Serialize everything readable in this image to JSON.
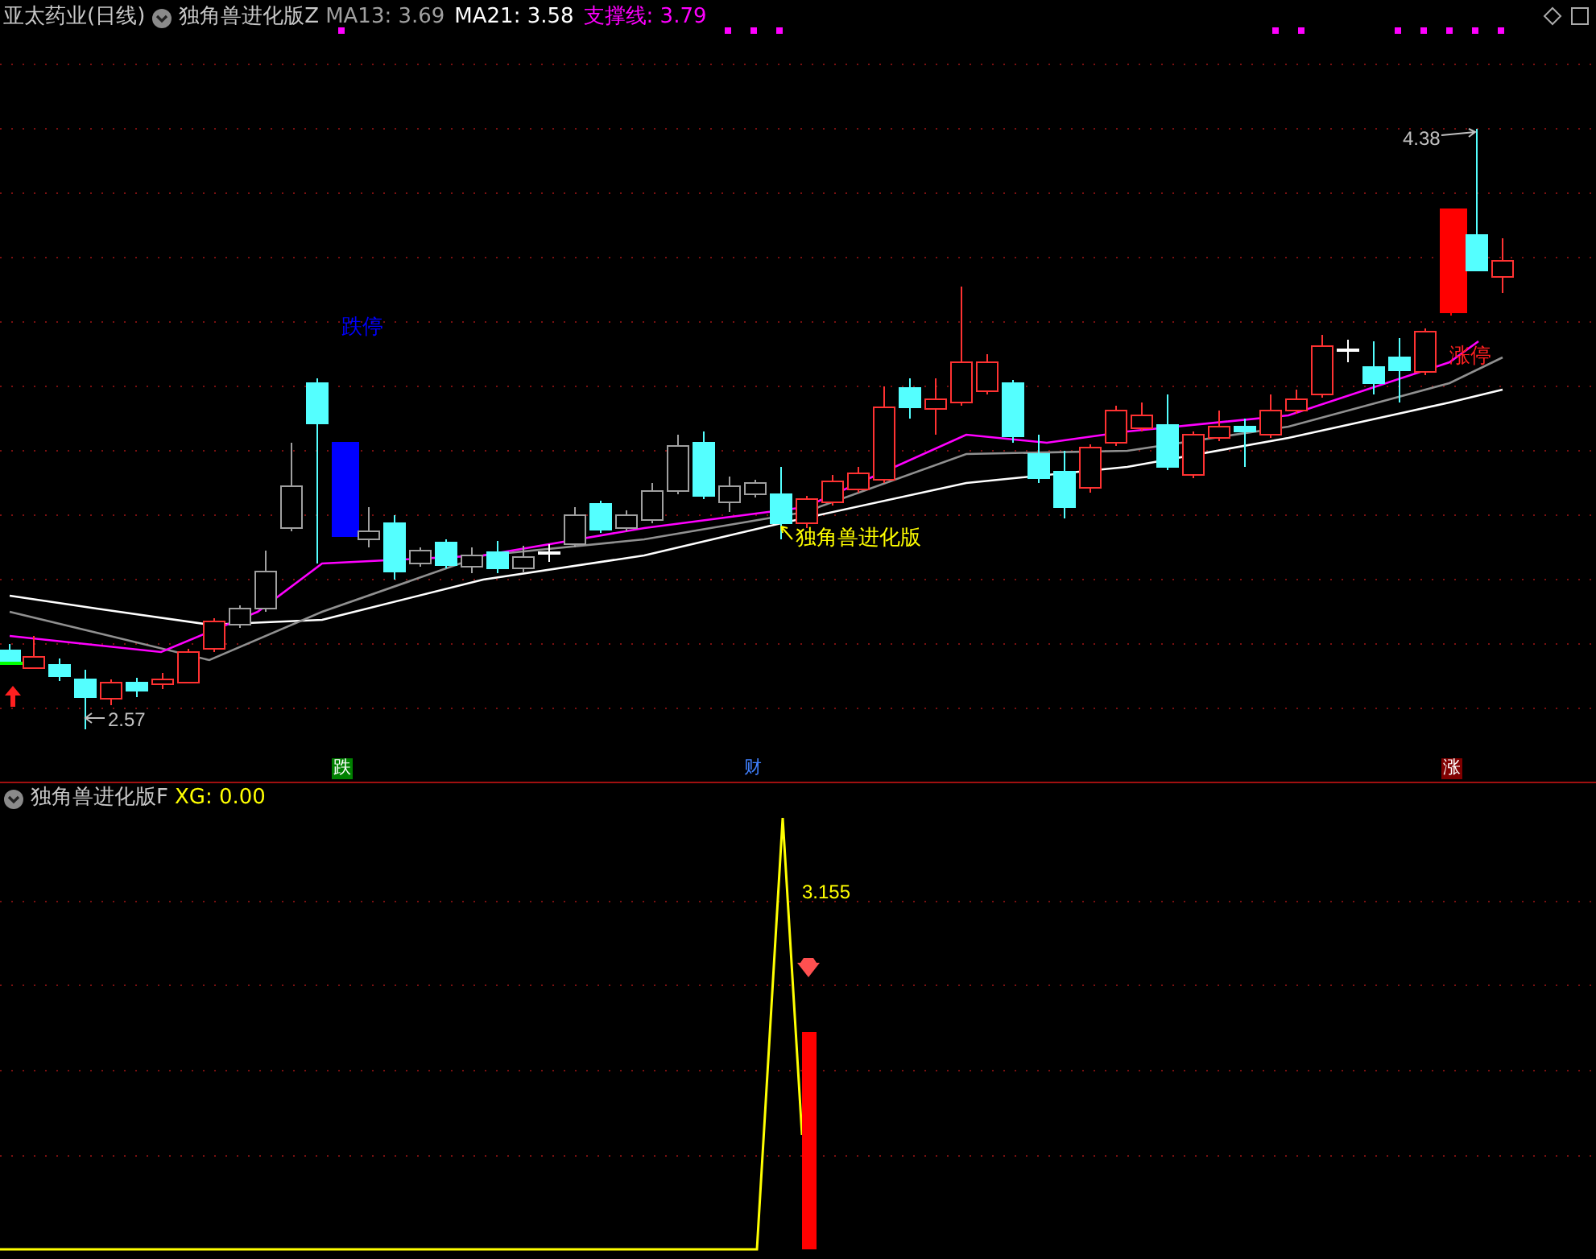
{
  "main_panel": {
    "title": "亚太药业(日线)",
    "indicator": "独角兽进化版Z",
    "readouts": [
      {
        "text": "MA13: 3.69",
        "color": "#a0a0a0"
      },
      {
        "text": "MA21: 3.58",
        "color": "#ffffff"
      },
      {
        "text": "支撑线: 3.79",
        "color": "#ff00ff"
      }
    ],
    "labels": [
      {
        "kind": "limit-down",
        "text": "跌停"
      },
      {
        "kind": "signal",
        "text": "独角兽进化版"
      },
      {
        "kind": "limit-up",
        "text": "涨停"
      },
      {
        "kind": "high",
        "text": "4.38"
      },
      {
        "kind": "low",
        "text": "2.57"
      }
    ],
    "markers": [
      {
        "kind": "down",
        "text": "跌"
      },
      {
        "kind": "finance",
        "text": "财"
      },
      {
        "kind": "up",
        "text": "涨"
      }
    ]
  },
  "sub_panel": {
    "title": "独角兽进化版F",
    "readout": "XG: 0.00",
    "peak_label": "3.155"
  }
}
